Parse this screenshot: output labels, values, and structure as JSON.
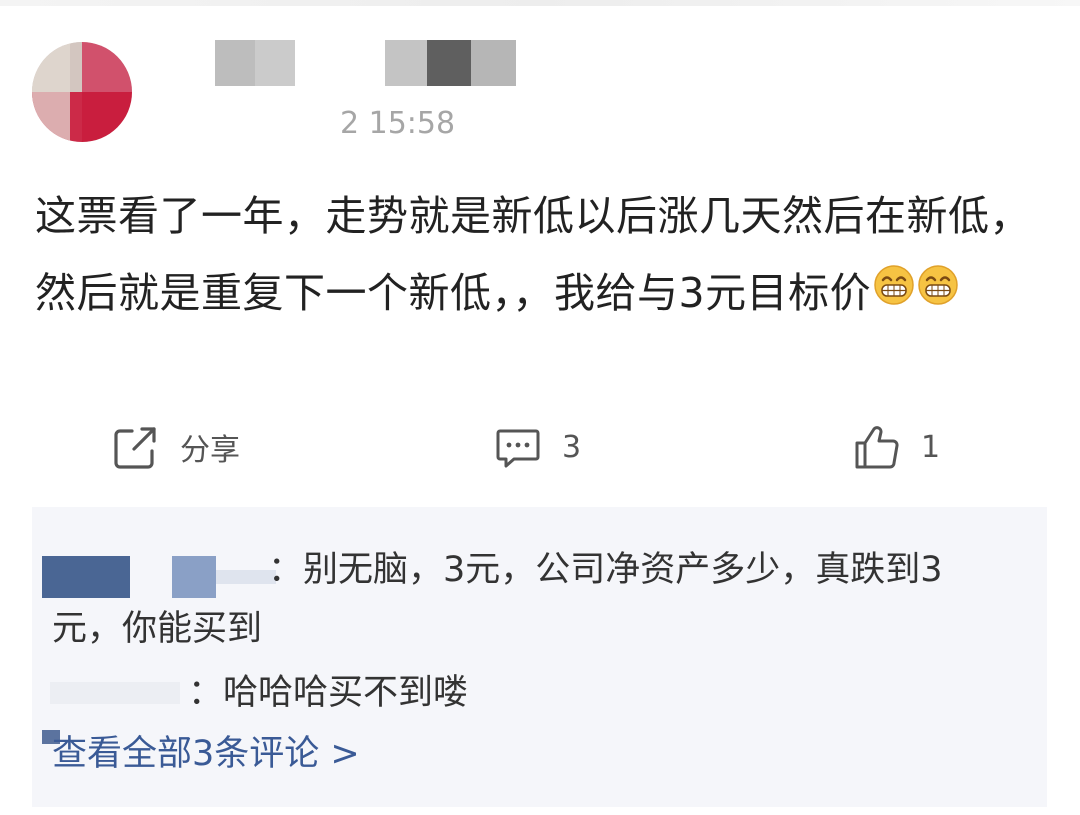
{
  "post": {
    "timestamp": "2 15:58",
    "text": "这票看了一年，走势就是新低以后涨几天然后在新低，然后就是重复下一个新低，，我给与3元目标价",
    "emoji_icons": [
      "grinning-face-icon",
      "grinning-face-icon"
    ]
  },
  "actions": {
    "share_label": "分享",
    "comment_count": "3",
    "like_count": "1",
    "share_icon": "share-icon",
    "comment_icon": "comment-icon",
    "like_icon": "thumbs-up-icon"
  },
  "comments": {
    "first_text": "：别无脑，3元，公司净资产多少，真跌到3",
    "first_text_cont": "元，你能买到",
    "second_text": "：哈哈哈买不到喽",
    "view_all_label": "查看全部3条评论 >"
  },
  "colors": {
    "link": "#3a5a96",
    "panel_bg": "#f5f6fa",
    "timestamp": "#a6a6a6",
    "icon": "#555555"
  }
}
